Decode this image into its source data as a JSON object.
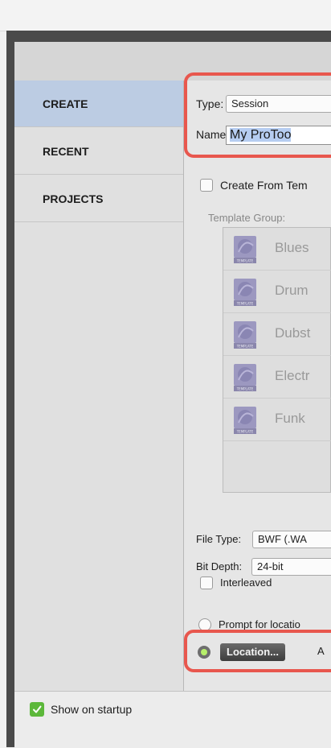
{
  "sidebar": {
    "items": [
      {
        "label": "CREATE",
        "active": true
      },
      {
        "label": "RECENT",
        "active": false
      },
      {
        "label": "PROJECTS",
        "active": false
      }
    ]
  },
  "create": {
    "type_label": "Type:",
    "type_value": "Session",
    "name_label": "Name:",
    "name_value": "My ProToo",
    "from_template_label": "Create From Tem",
    "template_group_label": "Template Group:",
    "templates": [
      {
        "name": "Blues",
        "badge": "TEMPLATE"
      },
      {
        "name": "Drum",
        "badge": "TEMPLATE"
      },
      {
        "name": "Dubst",
        "badge": "TEMPLATE"
      },
      {
        "name": "Electr",
        "badge": "TEMPLATE"
      },
      {
        "name": "Funk",
        "badge": "TEMPLATE"
      }
    ],
    "file_type_label": "File Type:",
    "file_type_value": "BWF (.WA",
    "bit_depth_label": "Bit Depth:",
    "bit_depth_value": "24-bit",
    "interleaved_label": "Interleaved",
    "prompt_location_label": "Prompt for locatio",
    "location_button_label": "Location...",
    "location_trailing": "A"
  },
  "footer": {
    "show_on_startup_label": "Show on startup"
  },
  "colors": {
    "highlight": "#e8574e",
    "sidebar_active": "#bccce3",
    "checkbox_green": "#5cb83a"
  }
}
